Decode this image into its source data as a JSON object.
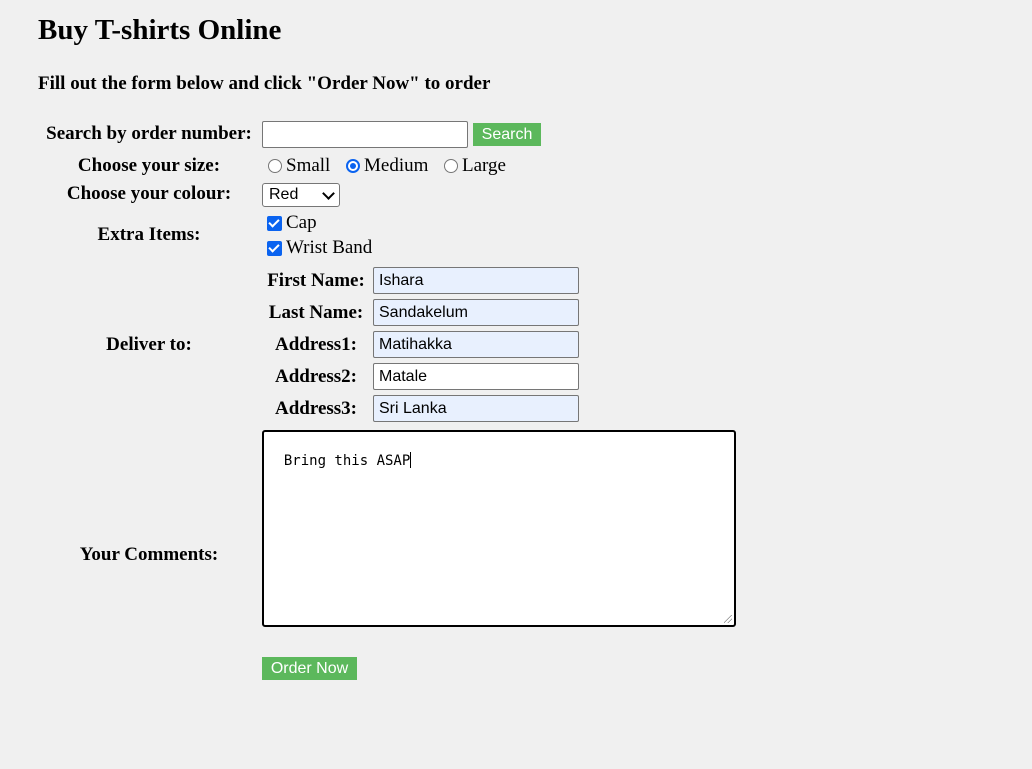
{
  "page": {
    "title": "Buy T-shirts Online",
    "subtitle": "Fill out the form below and click \"Order Now\" to order"
  },
  "search": {
    "label": "Search by order number:",
    "value": "",
    "button_label": "Search"
  },
  "size": {
    "label": "Choose your size:",
    "options": [
      "Small",
      "Medium",
      "Large"
    ],
    "selected": "Medium"
  },
  "colour": {
    "label": "Choose your colour:",
    "selected": "Red"
  },
  "extras": {
    "label": "Extra Items:",
    "items": [
      {
        "label": "Cap",
        "checked": true
      },
      {
        "label": "Wrist Band",
        "checked": true
      }
    ]
  },
  "deliver": {
    "label": "Deliver to:",
    "fields": [
      {
        "label": "First Name:",
        "value": "Ishara"
      },
      {
        "label": "Last Name:",
        "value": "Sandakelum"
      },
      {
        "label": "Address1:",
        "value": "Matihakka"
      },
      {
        "label": "Address2:",
        "value": "Matale"
      },
      {
        "label": "Address3:",
        "value": "Sri Lanka"
      }
    ]
  },
  "comments": {
    "label": "Your Comments:",
    "value": "Bring this ASAP"
  },
  "submit": {
    "label": "Order Now"
  },
  "colors": {
    "button_green": "#5cb85c",
    "autofill_blue": "#e8f0fe",
    "accent_blue": "#0a63f0",
    "background": "#f0f0f0"
  }
}
